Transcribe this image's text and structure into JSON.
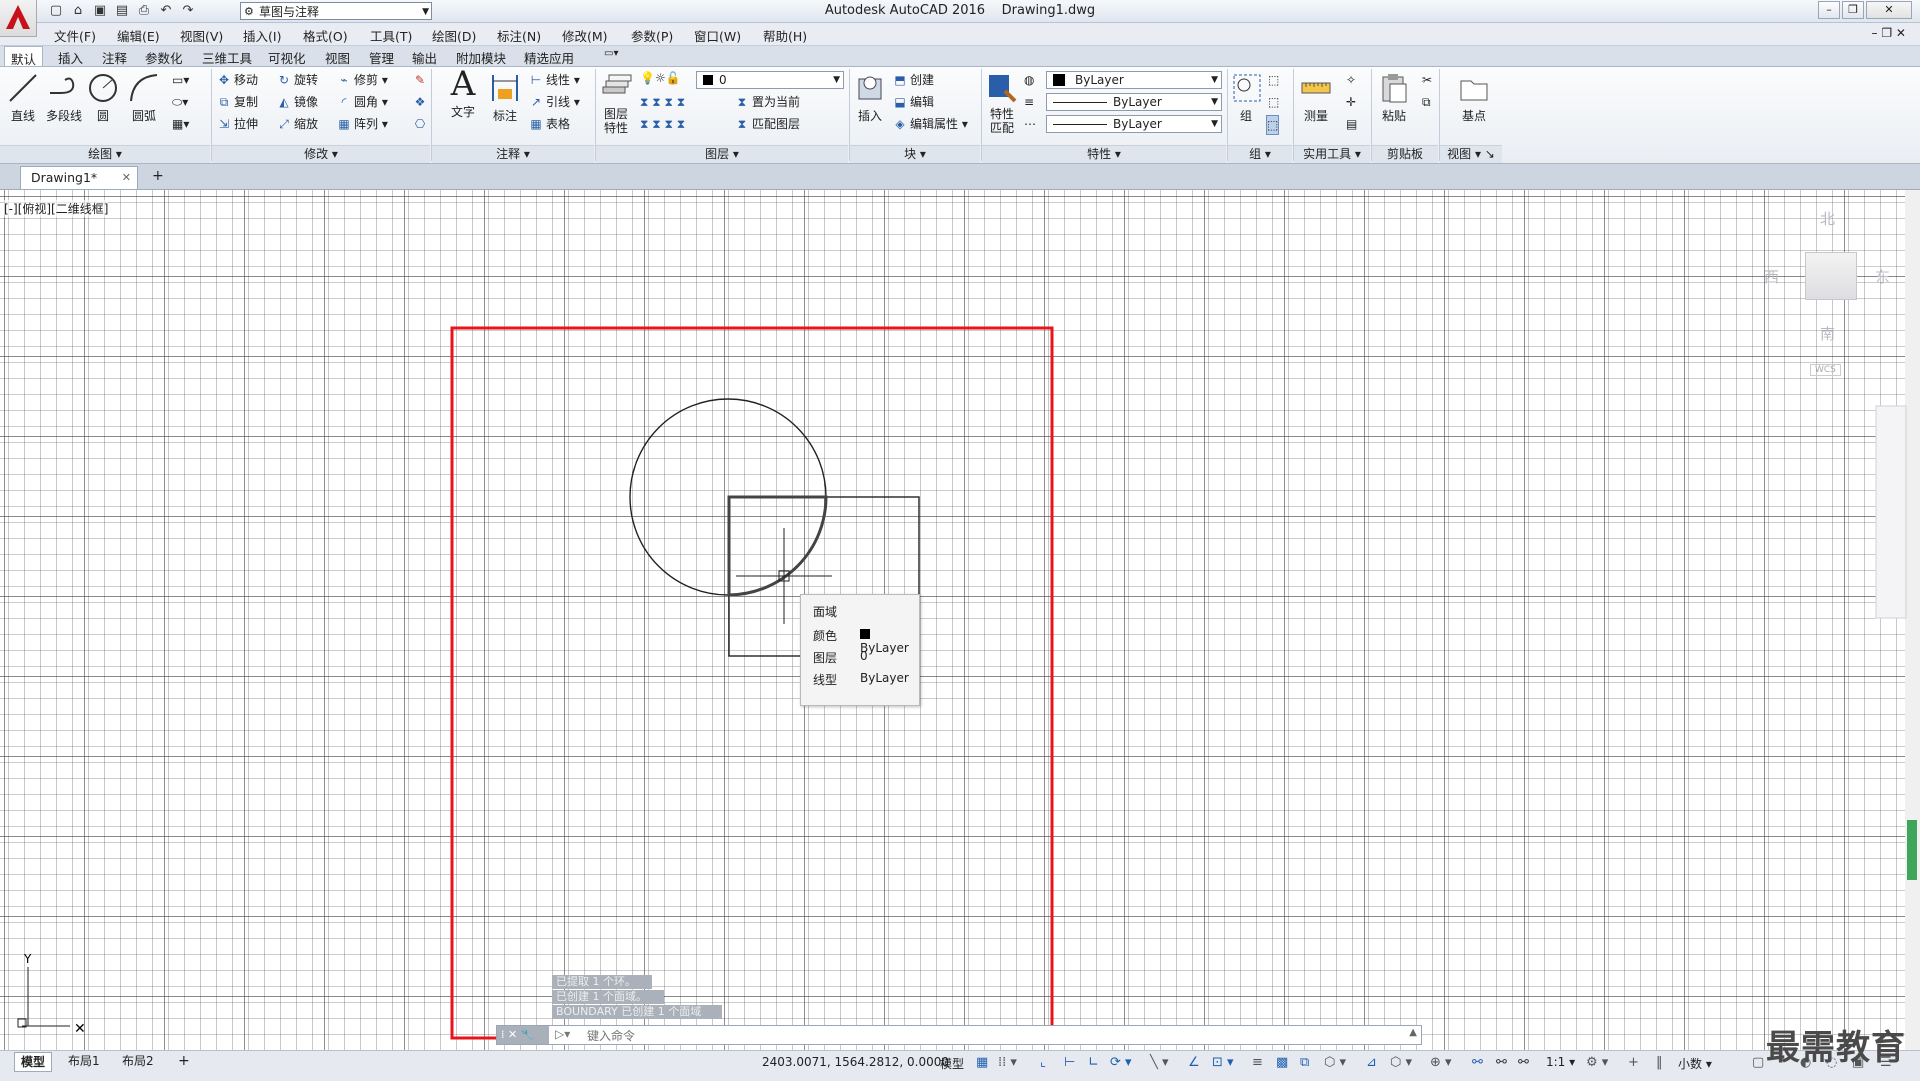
{
  "window": {
    "title": "Autodesk AutoCAD 2016    Drawing1.dwg"
  },
  "workspace": {
    "selected": "草图与注释"
  },
  "menu": [
    "文件(F)",
    "编辑(E)",
    "视图(V)",
    "插入(I)",
    "格式(O)",
    "工具(T)",
    "绘图(D)",
    "标注(N)",
    "修改(M)",
    "参数(P)",
    "窗口(W)",
    "帮助(H)"
  ],
  "ribbon_tabs": [
    "默认",
    "插入",
    "注释",
    "参数化",
    "三维工具",
    "可视化",
    "视图",
    "管理",
    "输出",
    "附加模块",
    "精选应用"
  ],
  "panels": {
    "draw": {
      "title": "绘图",
      "line": "直线",
      "polyline": "多段线",
      "circle": "圆",
      "arc": "圆弧"
    },
    "modify": {
      "title": "修改",
      "move": "移动",
      "rotate": "旋转",
      "trim": "修剪",
      "copy": "复制",
      "mirror": "镜像",
      "fillet": "圆角",
      "stretch": "拉伸",
      "scale": "缩放",
      "array": "阵列"
    },
    "annotation": {
      "title": "注释",
      "text": "文字",
      "dimension": "标注",
      "linear": "线性",
      "leader": "引线",
      "table": "表格"
    },
    "layers": {
      "title": "图层",
      "props": "图层\n特性",
      "current_layer": "0",
      "make_current": "置为当前",
      "match_layer": "匹配图层"
    },
    "block": {
      "title": "块",
      "insert": "插入",
      "create": "创建",
      "edit": "编辑",
      "edit_attr": "编辑属性"
    },
    "properties": {
      "title": "特性",
      "match": "特性\n匹配",
      "color": "ByLayer",
      "linetype": "ByLayer",
      "lineweight": "ByLayer"
    },
    "groups": {
      "title": "组",
      "group": "组"
    },
    "utilities": {
      "title": "实用工具",
      "measure": "测量"
    },
    "clipboard": {
      "title": "剪贴板",
      "paste": "粘贴"
    },
    "view": {
      "title": "视图",
      "base": "基点"
    }
  },
  "doc_tab": {
    "label": "Drawing1*"
  },
  "viewport": {
    "label": "[-][俯视][二维线框]"
  },
  "viewcube": {
    "north": "北",
    "south": "南",
    "east": "东",
    "west": "西",
    "wcs": "WCS"
  },
  "tooltip": {
    "title": "面域",
    "rows": [
      {
        "label": "颜色",
        "value": "ByLayer"
      },
      {
        "label": "图层",
        "value": "0"
      },
      {
        "label": "线型",
        "value": "ByLayer"
      }
    ]
  },
  "command": {
    "history": [
      "已提取 1 个环。",
      "已创建 1 个面域。",
      "BOUNDARY 已创建 1 个面域"
    ],
    "placeholder": "键入命令"
  },
  "layout_tabs": [
    "模型",
    "布局1",
    "布局2"
  ],
  "status": {
    "coords": "2403.0071, 1564.2812, 0.0000",
    "mode": "模型",
    "scale": "1:1",
    "units": "小数"
  },
  "watermark": "最需教育",
  "colors": {
    "highlight": "#e8141c",
    "ribbon_bg": "#eef1f5",
    "grid": "#777777"
  }
}
